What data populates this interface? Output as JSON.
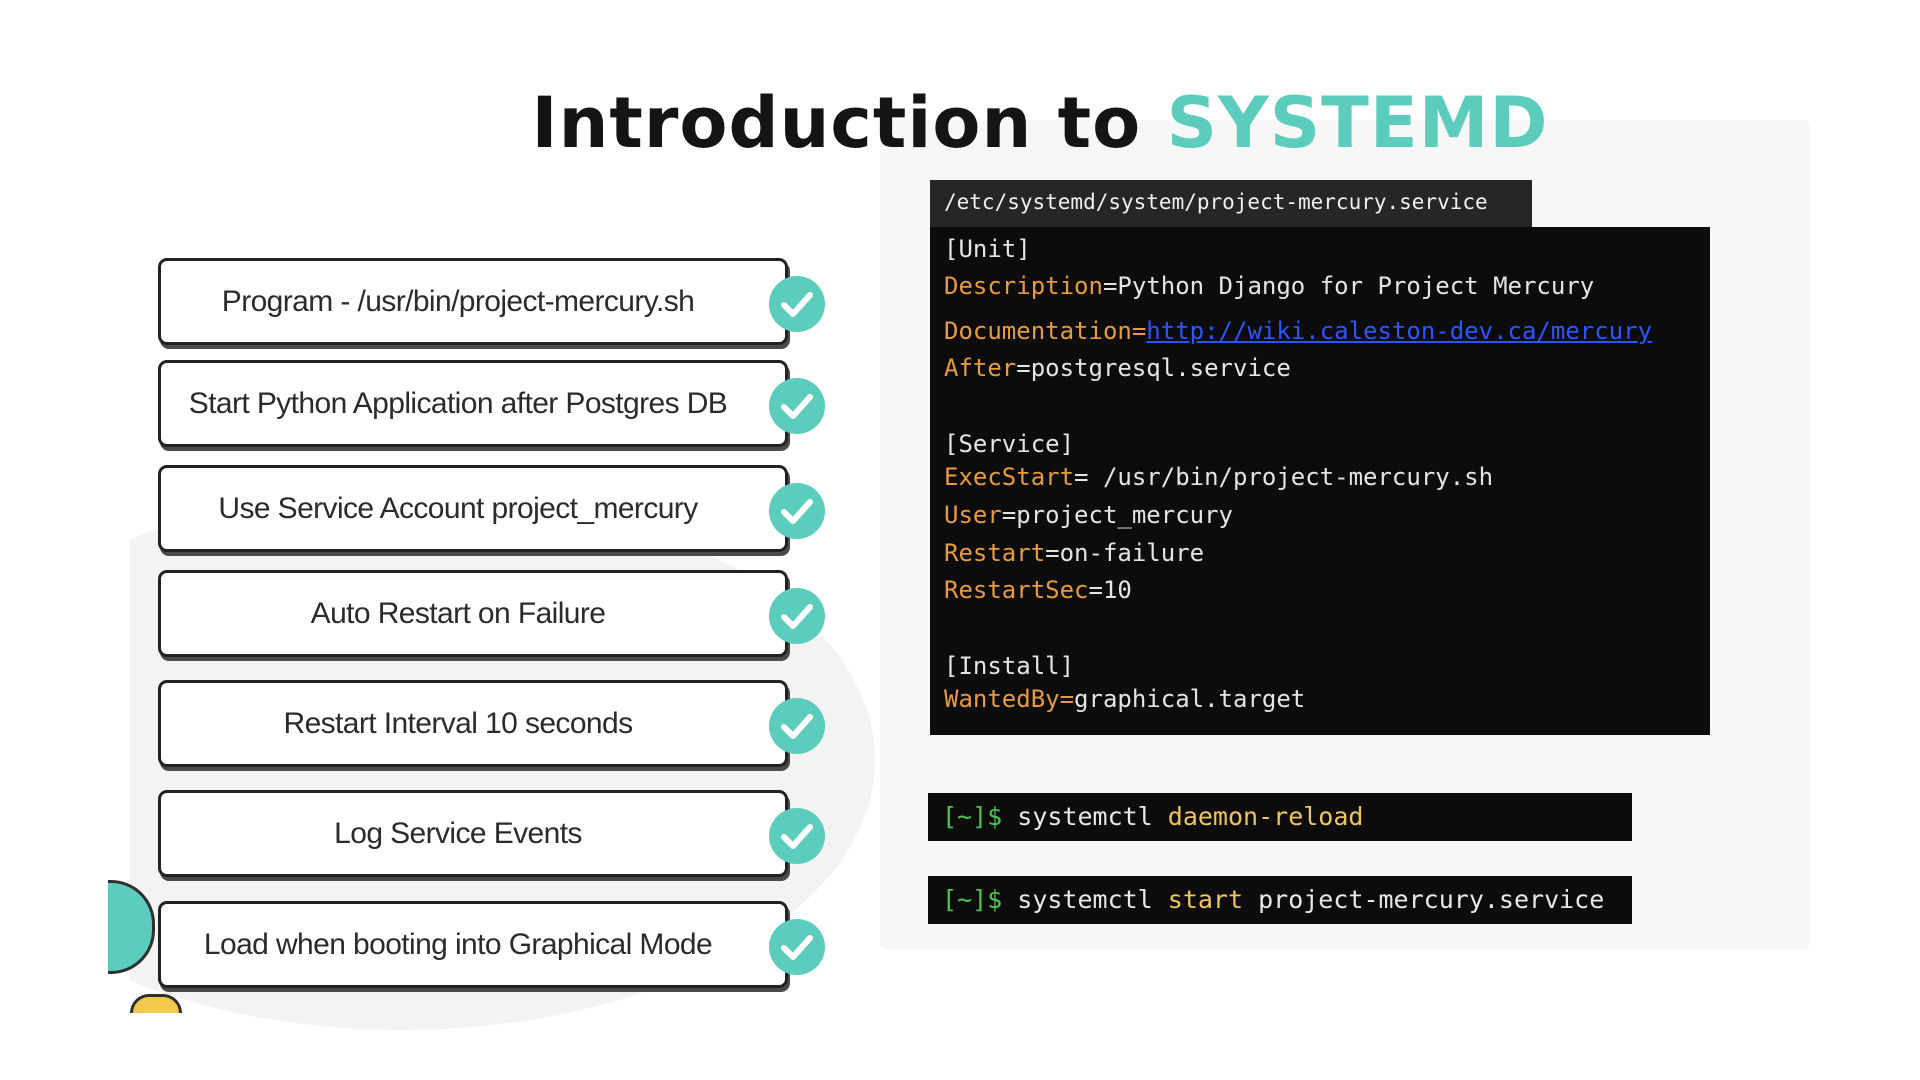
{
  "title": {
    "main": "Introduction to",
    "accent": "SYSTEMD"
  },
  "requirements": [
    "Program - /usr/bin/project-mercury.sh",
    "Start Python Application after Postgres DB",
    "Use Service Account project_mercury",
    "Auto Restart on Failure",
    "Restart Interval 10 seconds",
    "Log Service Events",
    "Load when booting into Graphical Mode"
  ],
  "unit_file": {
    "path": "/etc/systemd/system/project-mercury.service",
    "unit_header": "[Unit]",
    "description_key": "Description",
    "description_value": "=Python Django for Project Mercury",
    "documentation_key": "Documentation=",
    "documentation_value": "http://wiki.caleston-dev.ca/mercury",
    "after_key": "After",
    "after_value": "=postgresql.service",
    "service_header": "[Service]",
    "execstart_key": "ExecStart",
    "execstart_value": "= /usr/bin/project-mercury.sh",
    "user_key": "User",
    "user_value": "=project_mercury",
    "restart_key": "Restart",
    "restart_value": "=on-failure",
    "restartsec_key": "RestartSec",
    "restartsec_value": "=10",
    "install_header": "[Install]",
    "wantedby_key": "WantedBy=",
    "wantedby_value": "graphical.target"
  },
  "commands": [
    {
      "prompt": "[~]$ ",
      "cmd": "systemctl ",
      "arg": "daemon-reload",
      "rest": ""
    },
    {
      "prompt": "[~]$ ",
      "cmd": "systemctl ",
      "arg": "start",
      "rest": " project-mercury.service"
    }
  ],
  "colors": {
    "accent": "#5ccdbc",
    "key": "#e89b3e",
    "prompt": "#4ec552",
    "link": "#2b56ff",
    "terminal_bg": "#0c0c0c"
  },
  "icons": {
    "check": "check-circle-icon"
  }
}
